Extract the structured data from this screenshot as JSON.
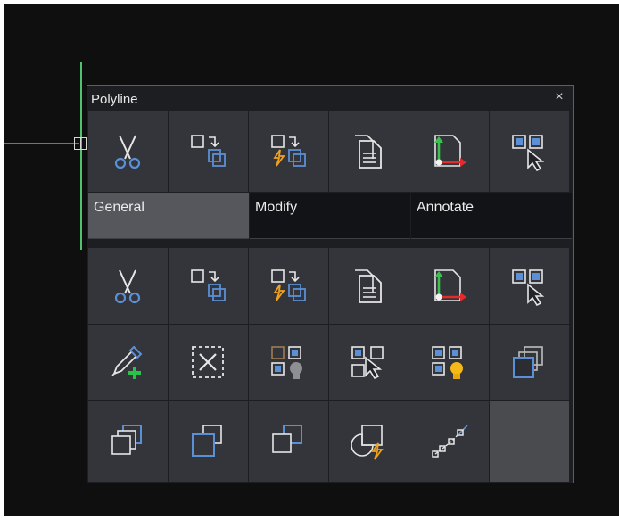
{
  "panel": {
    "title": "Polyline",
    "close_glyph": "×"
  },
  "quick_row": [
    {
      "icon": "scissors-icon",
      "name": "cut-button"
    },
    {
      "icon": "copy-move-icon",
      "name": "copy-move-button"
    },
    {
      "icon": "quick-copy-icon",
      "name": "quick-copy-button"
    },
    {
      "icon": "paste-document-icon",
      "name": "paste-button"
    },
    {
      "icon": "ucs-axes-document-icon",
      "name": "copy-basepoint-button"
    },
    {
      "icon": "select-similar-icon",
      "name": "select-similar-button"
    }
  ],
  "tabs": [
    {
      "label": "General",
      "active": true
    },
    {
      "label": "Modify",
      "active": false
    },
    {
      "label": "Annotate",
      "active": false
    }
  ],
  "tool_rows": [
    [
      {
        "icon": "scissors-icon",
        "name": "cut-button"
      },
      {
        "icon": "copy-move-icon",
        "name": "copy-move-button"
      },
      {
        "icon": "quick-copy-icon",
        "name": "quick-copy-button"
      },
      {
        "icon": "paste-document-icon",
        "name": "paste-button"
      },
      {
        "icon": "ucs-axes-document-icon",
        "name": "copy-basepoint-button"
      },
      {
        "icon": "select-similar-icon",
        "name": "select-similar-button"
      }
    ],
    [
      {
        "icon": "eyedropper-add-icon",
        "name": "match-properties-button"
      },
      {
        "icon": "deselect-icon",
        "name": "deselect-button"
      },
      {
        "icon": "isolate-bulb-gray-icon",
        "name": "isolate-objects-button"
      },
      {
        "icon": "select-cursor-icon",
        "name": "quick-select-button"
      },
      {
        "icon": "show-bulb-yellow-icon",
        "name": "show-objects-button"
      },
      {
        "icon": "bring-to-front-icon",
        "name": "draw-order-front-button"
      }
    ],
    [
      {
        "icon": "send-to-back-icon",
        "name": "draw-order-back-button"
      },
      {
        "icon": "bring-above-icon",
        "name": "draw-order-above-button"
      },
      {
        "icon": "send-under-icon",
        "name": "draw-order-under-button"
      },
      {
        "icon": "boundary-lightning-icon",
        "name": "boundary-button"
      },
      {
        "icon": "polyline-edit-icon",
        "name": "polyline-edit-button"
      },
      {
        "icon": "",
        "name": "empty-slot"
      }
    ]
  ],
  "colors": {
    "background": "#0f0f10",
    "panel": "#1d1e21",
    "cell": "#33353a",
    "active_tab": "#55575c",
    "polyline": "#a24fbf",
    "axis_line": "#4fc36e",
    "accent_blue": "#5b8fd6",
    "accent_orange": "#f0a21f"
  }
}
